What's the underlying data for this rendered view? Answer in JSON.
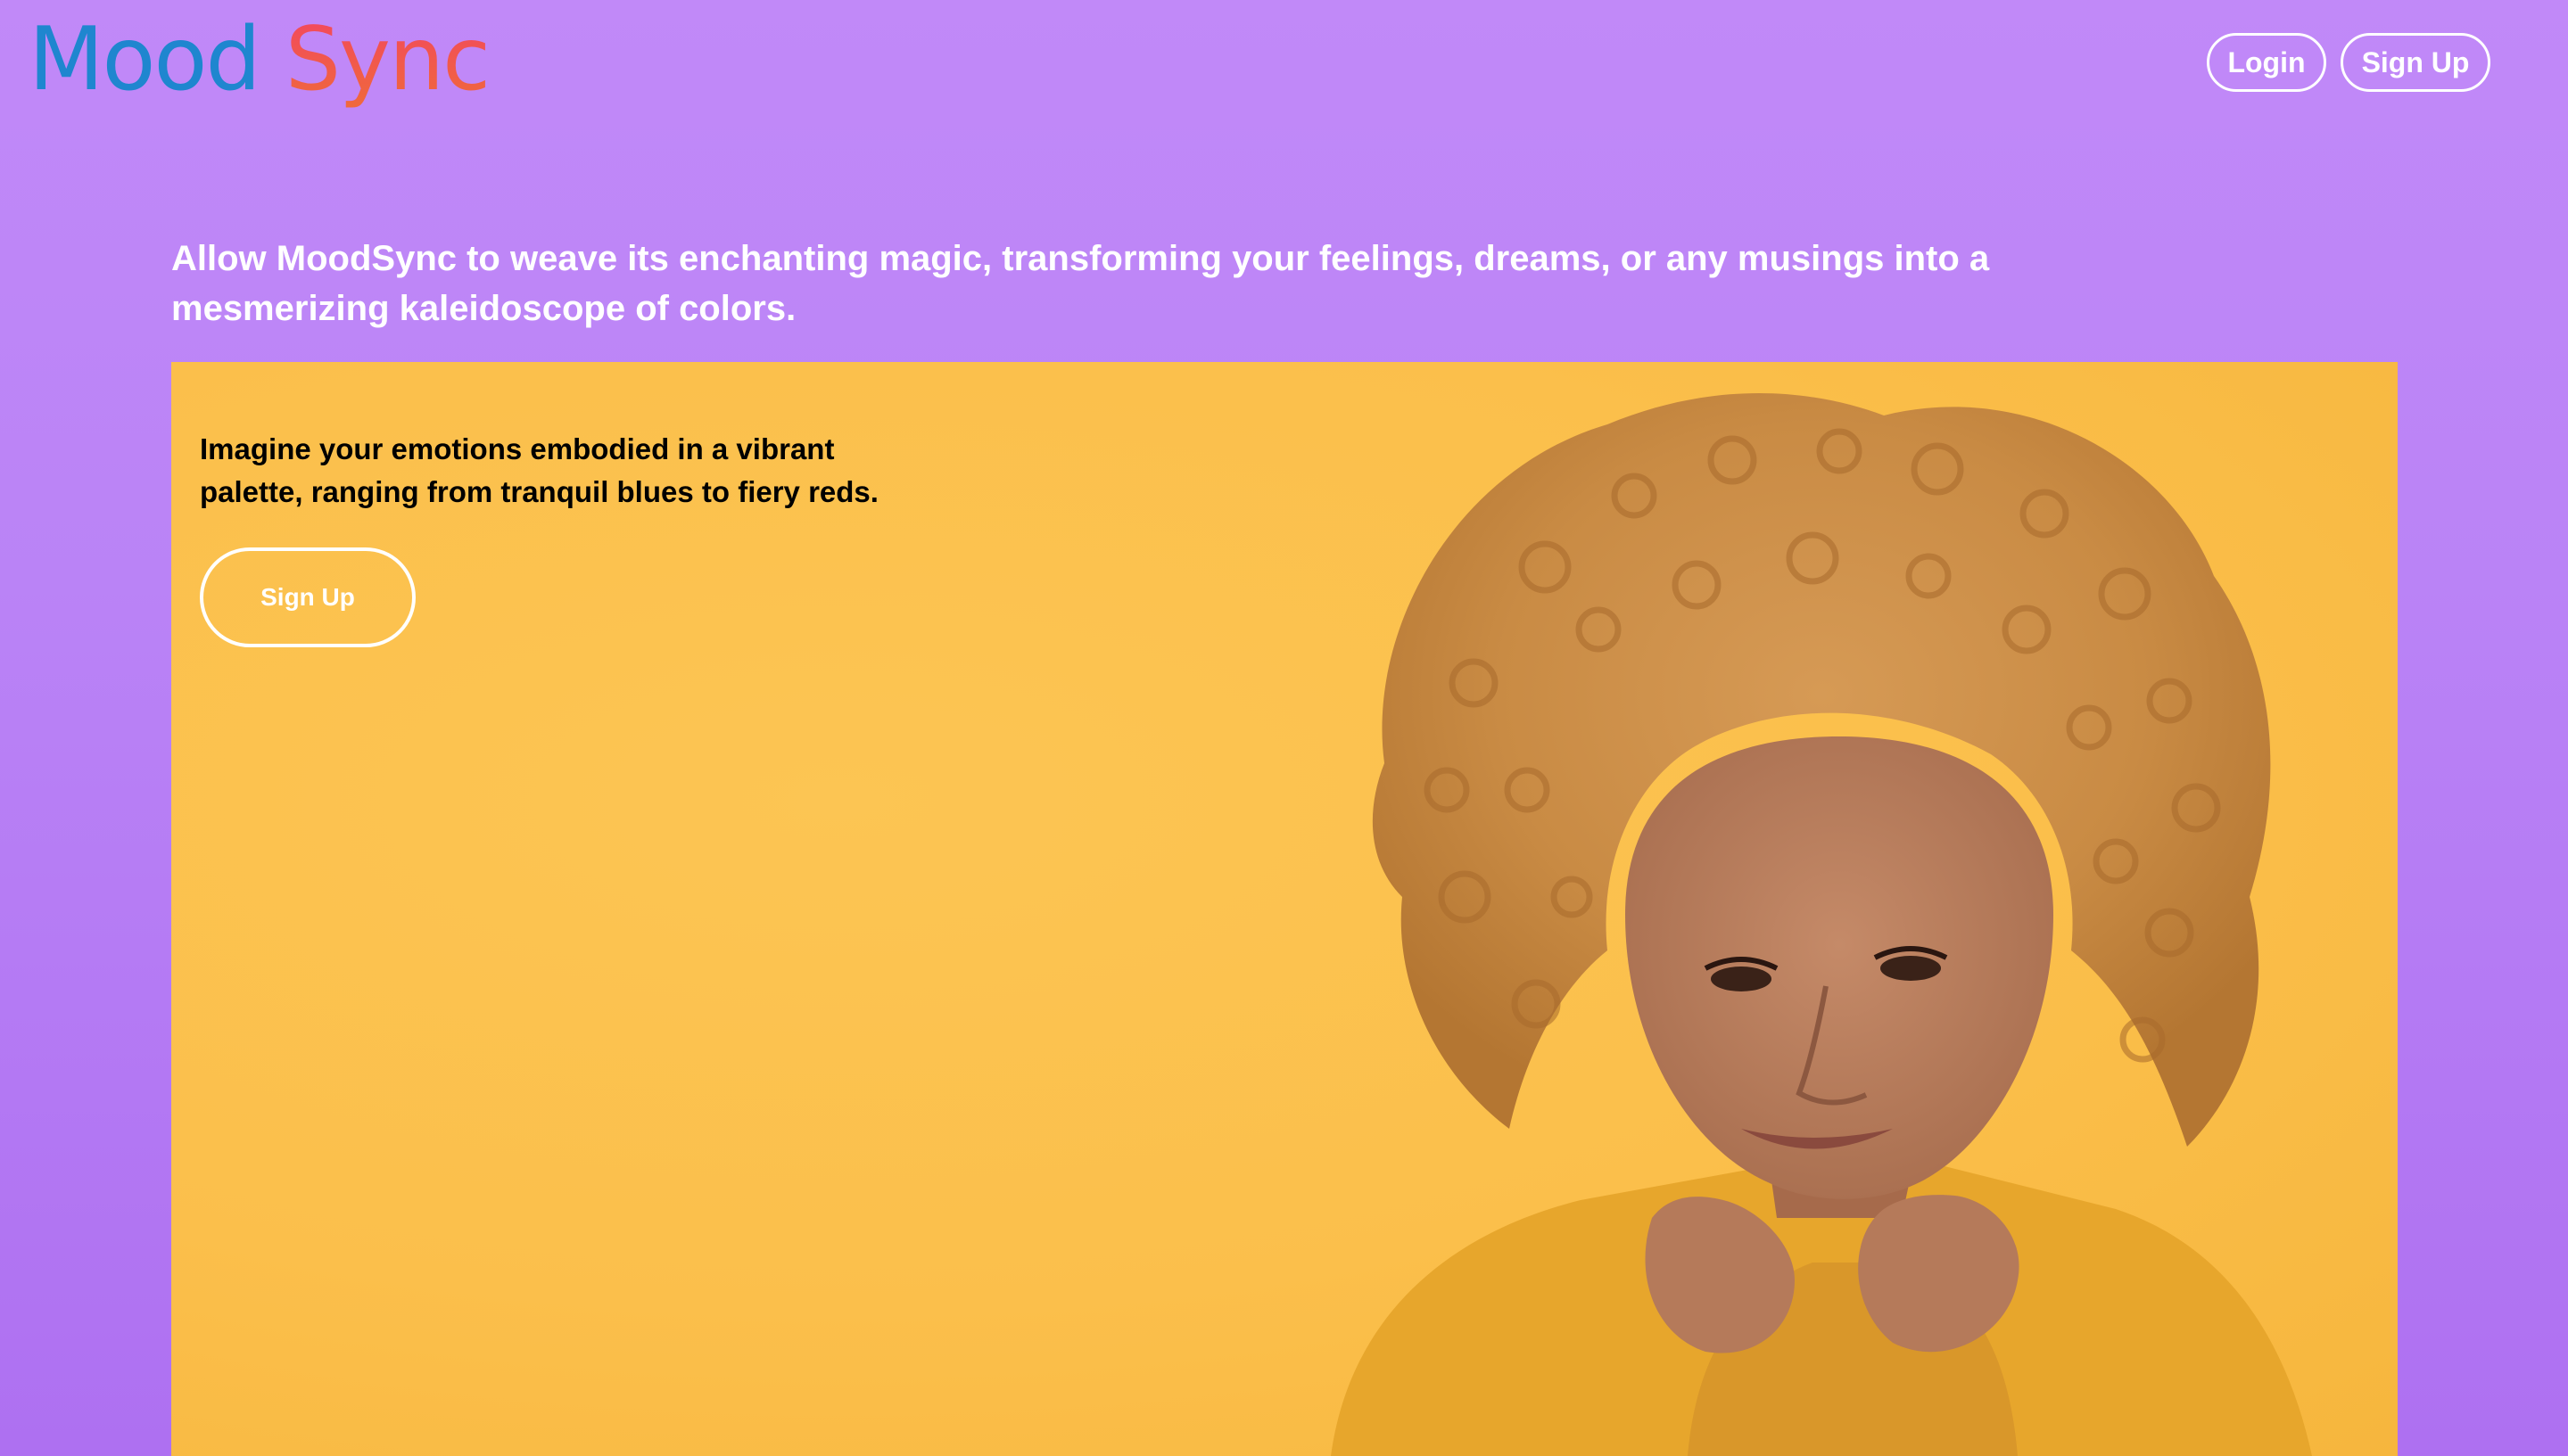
{
  "header": {
    "logo_word1": "Mood",
    "logo_word2": "Sync",
    "login_label": "Login",
    "signup_label": "Sign Up"
  },
  "tagline": "Allow MoodSync to weave its enchanting magic, transforming your feelings, dreams, or any musings into a mesmerizing kaleidoscope of colors.",
  "hero": {
    "text": "Imagine your emotions embodied in a vibrant palette, ranging from tranquil blues to fiery reds.",
    "signup_label": "Sign Up",
    "image_icon": "portrait-photo"
  },
  "colors": {
    "background_top": "#c189f8",
    "background_bottom": "#ae70f1",
    "logo_blue": "#1f86cf",
    "logo_red": "#f24660",
    "hero_yellow": "#fbbf4b"
  }
}
